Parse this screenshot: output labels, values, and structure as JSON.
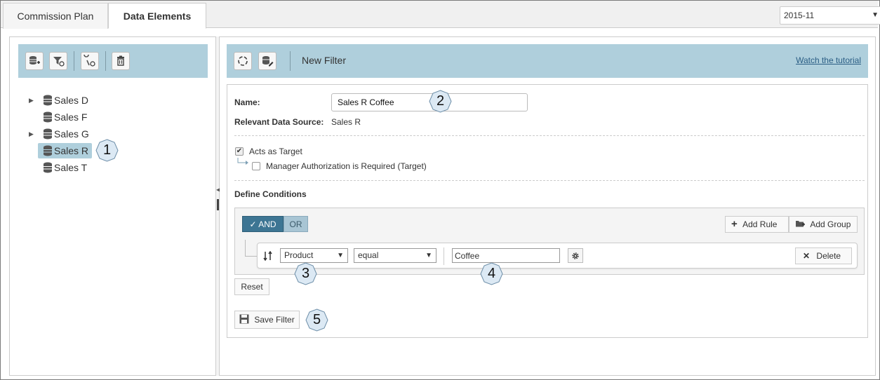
{
  "tabs": [
    {
      "label": "Commission Plan",
      "active": false
    },
    {
      "label": "Data Elements",
      "active": true
    }
  ],
  "period": {
    "value": "2015-11"
  },
  "left_toolbar": {
    "icons": [
      "add-data-source-icon",
      "filter-icon",
      "data-settings-icon",
      "trash-icon"
    ]
  },
  "tree": {
    "items": [
      {
        "label": "Sales D",
        "expandable": true,
        "selected": false
      },
      {
        "label": "Sales F",
        "expandable": false,
        "selected": false
      },
      {
        "label": "Sales G",
        "expandable": true,
        "selected": false
      },
      {
        "label": "Sales R",
        "expandable": false,
        "selected": true
      },
      {
        "label": "Sales T",
        "expandable": false,
        "selected": false
      }
    ]
  },
  "right_toolbar": {
    "title": "New Filter",
    "tutorial_link": "Watch the tutorial",
    "icons": [
      "refresh-icon",
      "data-edit-icon"
    ]
  },
  "form": {
    "name_label": "Name:",
    "name_value": "Sales R Coffee",
    "source_label": "Relevant Data Source:",
    "source_value": "Sales R",
    "acts_as_target_label": "Acts as Target",
    "acts_as_target_checked": true,
    "manager_auth_label": "Manager Authorization is Required (Target)",
    "manager_auth_checked": false,
    "define_conditions_label": "Define Conditions"
  },
  "conditions": {
    "and_label": "AND",
    "or_label": "OR",
    "add_rule_label": "Add Rule",
    "add_group_label": "Add Group",
    "rule": {
      "field": "Product",
      "operator": "equal",
      "value": "Coffee",
      "delete_label": "Delete"
    }
  },
  "reset_label": "Reset",
  "save_label": "Save Filter",
  "callouts": [
    "1",
    "2",
    "3",
    "4",
    "5"
  ],
  "colors": {
    "toolbar_bg": "#afcfdc",
    "and_active": "#3d7593",
    "or_inactive": "#a8c5d4",
    "link": "#2a5d84"
  }
}
